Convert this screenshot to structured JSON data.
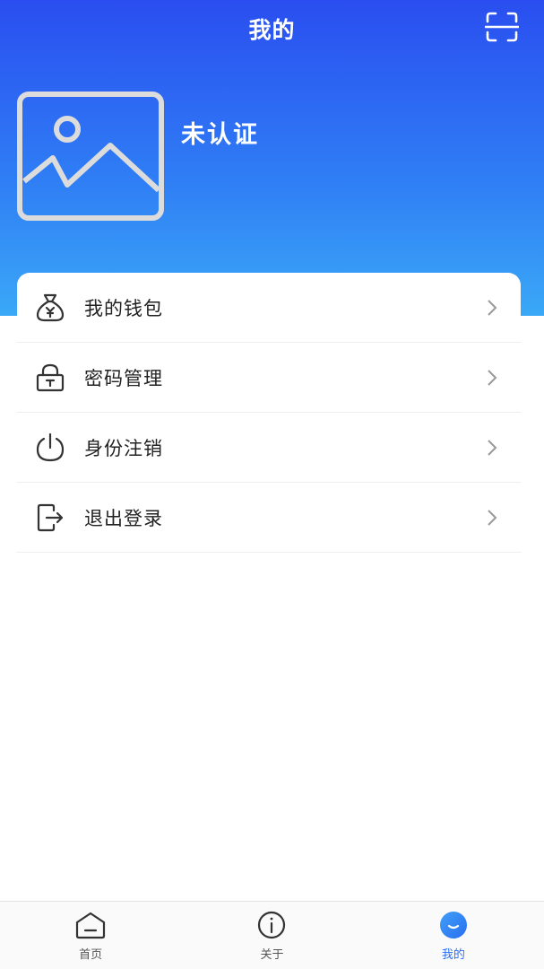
{
  "header": {
    "title": "我的",
    "scan_icon": "scan-icon"
  },
  "user": {
    "avatar_icon": "image-placeholder-icon",
    "status": "未认证"
  },
  "menu": {
    "items": [
      {
        "label": "我的钱包",
        "icon": "wallet-icon"
      },
      {
        "label": "密码管理",
        "icon": "lock-icon"
      },
      {
        "label": "身份注销",
        "icon": "power-icon"
      },
      {
        "label": "退出登录",
        "icon": "logout-icon"
      }
    ],
    "arrow_icon": "chevron-right-icon"
  },
  "tabbar": {
    "tabs": [
      {
        "label": "首页",
        "icon": "home-icon",
        "active": false
      },
      {
        "label": "关于",
        "icon": "info-icon",
        "active": false
      },
      {
        "label": "我的",
        "icon": "profile-icon",
        "active": true
      }
    ]
  },
  "colors": {
    "header_top": "#2a4ef0",
    "header_bottom": "#3aa8f6",
    "accent": "#2b6ff0",
    "text": "#222222"
  }
}
